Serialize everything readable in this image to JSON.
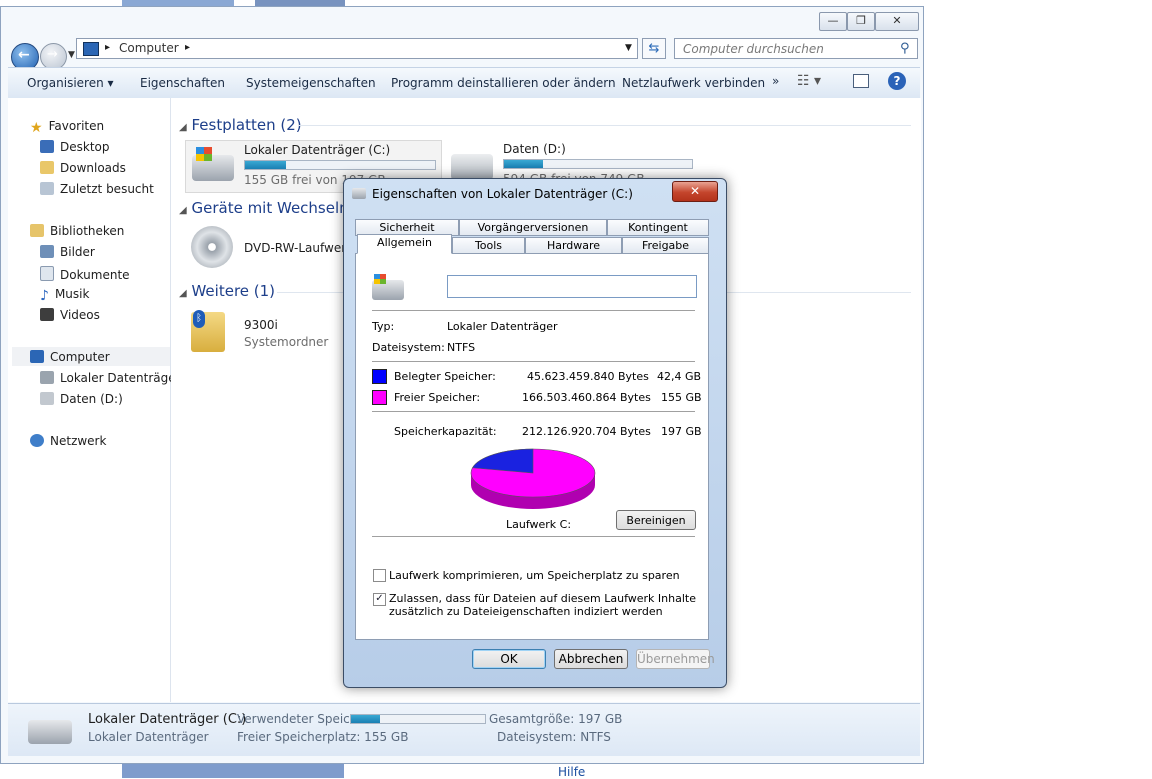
{
  "window": {
    "controls": [
      "—",
      "❐",
      "✕"
    ]
  },
  "address": {
    "crumb": "Computer",
    "search_placeholder": "Computer durchsuchen"
  },
  "toolbar": {
    "items": [
      "Organisieren",
      "Eigenschaften",
      "Systemeigenschaften",
      "Programm deinstallieren oder ändern",
      "Netzlaufwerk verbinden",
      "»"
    ]
  },
  "nav": {
    "favorites": "Favoriten",
    "desktop": "Desktop",
    "downloads": "Downloads",
    "recent": "Zuletzt besucht",
    "libraries": "Bibliotheken",
    "pictures": "Bilder",
    "documents": "Dokumente",
    "music": "Musik",
    "videos": "Videos",
    "computer": "Computer",
    "local_disk": "Lokaler Datenträger",
    "data_d": "Daten (D:)",
    "network": "Netzwerk"
  },
  "main": {
    "group_hdd": "Festplatten (2)",
    "group_removable": "Geräte mit Wechselme",
    "group_other": "Weitere (1)",
    "drive_c": {
      "name": "Lokaler Datenträger (C:)",
      "free": "155 GB frei von 197 GB",
      "used_fraction": 0.215
    },
    "drive_d": {
      "name": "Daten (D:)",
      "free": "594 GB frei von 749 GB",
      "used_fraction": 0.21
    },
    "dvd": {
      "name": "DVD-RW-Laufwerk"
    },
    "phone": {
      "name": "9300i",
      "sub": "Systemordner"
    }
  },
  "status": {
    "name": "Lokaler Datenträger (C:)",
    "type": "Lokaler Datenträger",
    "used_label": "Verwendeter Speic...",
    "free_label": "Freier Speicherplatz: 155 GB",
    "total_label": "Gesamtgröße: 197 GB",
    "fs_label": "Dateisystem: NTFS",
    "used_fraction": 0.215
  },
  "dialog": {
    "title": "Eigenschaften von Lokaler Datenträger (C:)",
    "close": "✕",
    "tabs_top": [
      "Sicherheit",
      "Vorgängerversionen",
      "Kontingent"
    ],
    "tabs_bottom": [
      "Allgemein",
      "Tools",
      "Hardware",
      "Freigabe"
    ],
    "label_value": "",
    "typ_label": "Typ:",
    "typ_value": "Lokaler Datenträger",
    "fs_label": "Dateisystem:",
    "fs_value": "NTFS",
    "used_label": "Belegter Speicher:",
    "used_bytes": "45.623.459.840 Bytes",
    "used_gb": "42,4 GB",
    "free_label": "Freier Speicher:",
    "free_bytes": "166.503.460.864 Bytes",
    "free_gb": "155 GB",
    "cap_label": "Speicherkapazität:",
    "cap_bytes": "212.126.920.704 Bytes",
    "cap_gb": "197 GB",
    "drive_label": "Laufwerk C:",
    "cleanup": "Bereinigen",
    "compress": "Laufwerk komprimieren, um Speicherplatz zu sparen",
    "index_line1": "Zulassen, dass für Dateien auf diesem Laufwerk Inhalte",
    "index_line2": "zusätzlich zu Dateieigenschaften indiziert werden",
    "compress_checked": false,
    "index_checked": true,
    "ok": "OK",
    "cancel": "Abbrechen",
    "apply": "Übernehmen",
    "used_color": "#0000ff",
    "free_color": "#ff00ff",
    "used_fraction": 0.215
  },
  "background": {
    "help": "Hilfe"
  }
}
